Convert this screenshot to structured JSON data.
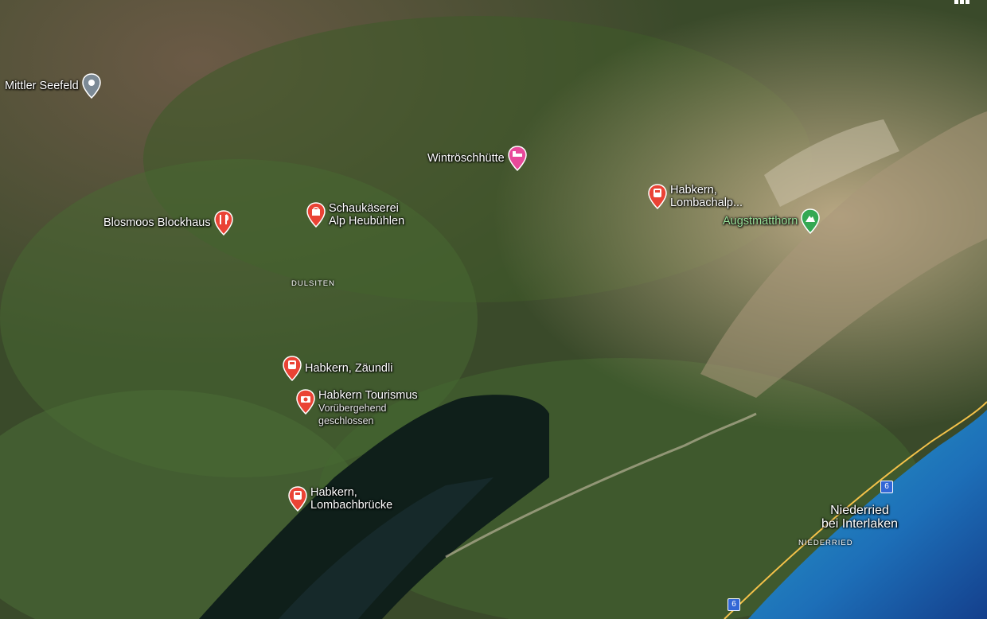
{
  "labels": {
    "mittler": "Mittler Seefeld",
    "wintrosch": "Wintröschhütte",
    "blosmoos": "Blosmoos Blockhaus",
    "schau_1": "Schaukäserei",
    "schau_2": "Alp Heubühlen",
    "lomb_alp_1": "Habkern,",
    "lomb_alp_2": "Lombachalp...",
    "augst": "Augstmatthorn",
    "dulsiten": "DULSITEN",
    "zaundli": "Habkern, Zäundli",
    "tour_1": "Habkern Tourismus",
    "tour_2": "Vorübergehend",
    "tour_3": "geschlossen",
    "lomb_br_1": "Habkern,",
    "lomb_br_2": "Lombachbrücke",
    "nied_1": "Niederried",
    "nied_2": "bei Interlaken",
    "niederried_area": "NIEDERRIED",
    "route_6a": "6",
    "route_6b": "6"
  },
  "icons": {
    "place": "place-pin-icon",
    "hotel": "hotel-bed-icon",
    "restaurant": "restaurant-fork-knife-icon",
    "shop": "shopping-bag-icon",
    "transit": "train-icon",
    "mountain": "mountain-icon",
    "camera": "camera-icon",
    "apps": "apps-grid-icon"
  },
  "colors": {
    "pin_red": "#ea4335",
    "pin_pink": "#e8499a",
    "pin_gray": "#7c8a96",
    "pin_green": "#34a853",
    "mountain_label": "#9be29b",
    "lake": "#1c7cc4",
    "route_badge": "#3367d6"
  }
}
